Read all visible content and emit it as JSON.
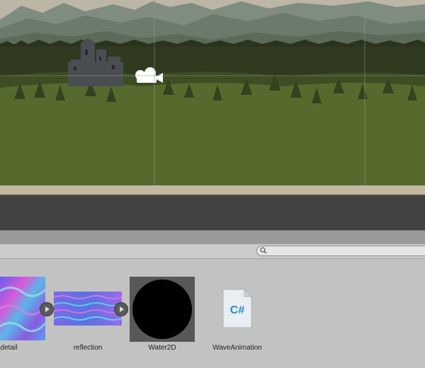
{
  "project_panel": {
    "search": {
      "placeholder": "",
      "value": ""
    }
  },
  "assets": [
    {
      "name": "normal_detail",
      "label": "rmal_detail",
      "type": "texture",
      "has_subassets": true
    },
    {
      "name": "reflection",
      "label": "reflection",
      "type": "texture",
      "has_subassets": true
    },
    {
      "name": "Water2D",
      "label": "Water2D",
      "type": "material",
      "selected": true
    },
    {
      "name": "WaveAnimation",
      "label": "WaveAnimation",
      "type": "csharp-script",
      "icon_text": "C#"
    }
  ],
  "icons": {
    "search": "search-icon",
    "expand": "play-triangle-icon",
    "camera": "camera-gizmo-icon",
    "script": "csharp-file-icon"
  },
  "colors": {
    "selection_bg": "#585858",
    "scene_grass": "#566a2e",
    "scene_trees": "#2f3a20",
    "scene_mountains": "#6b7a6b",
    "csharp_accent": "#2a89c9"
  }
}
